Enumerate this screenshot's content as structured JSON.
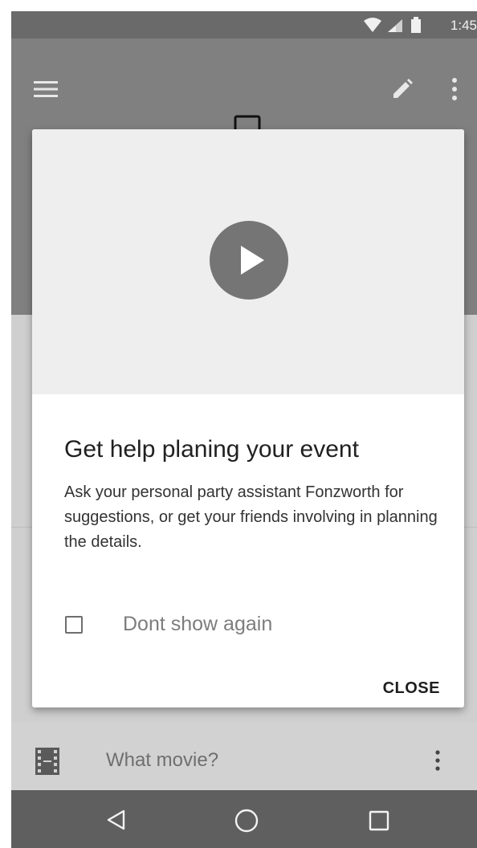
{
  "status_bar": {
    "time": "1:45",
    "icons": [
      "wifi-icon",
      "signal-icon",
      "battery-icon"
    ]
  },
  "toolbar": {
    "icons": [
      "menu-icon",
      "edit-icon",
      "more-vert-icon"
    ],
    "image_placeholder": "image-icon"
  },
  "dialog": {
    "title": "Get help planing your event",
    "body": "Ask your personal party assistant Fonzworth for suggestions, or get your friends involving in planning the details.",
    "checkbox_label": "Dont show again",
    "checkbox_checked": false,
    "close_label": "CLOSE",
    "media_icon": "play-icon"
  },
  "list": {
    "items": [
      {
        "icon": "movie-icon",
        "label": "What movie?",
        "action_icon": "more-vert-icon"
      }
    ]
  },
  "nav_bar": {
    "icons": [
      "back-icon",
      "home-icon",
      "recents-icon"
    ]
  },
  "colors": {
    "header": "#808080",
    "status_bar": "#6a6a6a",
    "nav_bar": "#5f5f5f",
    "scrim_content": "#cfcfcf",
    "play_circle": "#757575",
    "dialog_media_bg": "#eeeeee"
  }
}
